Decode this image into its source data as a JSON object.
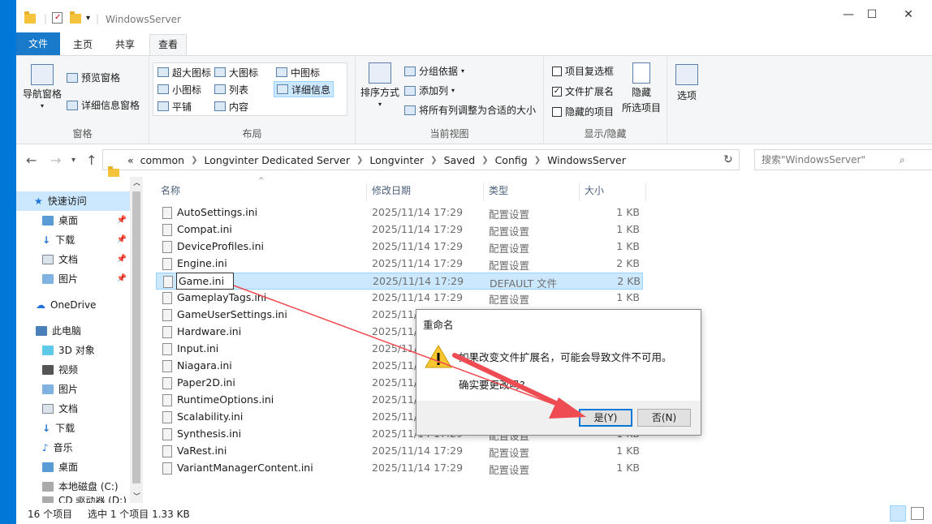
{
  "window": {
    "title": "WindowsServer",
    "minimize": "—",
    "maximize": "☐",
    "close": "✕"
  },
  "ribbon": {
    "tabs": [
      "文件",
      "主页",
      "共享",
      "查看"
    ],
    "panes": {
      "nav_pane": "导航窗格",
      "preview": "预览窗格",
      "details": "详细信息窗格",
      "label": "窗格"
    },
    "layout": {
      "items": [
        "超大图标",
        "大图标",
        "中图标",
        "小图标",
        "列表",
        "详细信息",
        "平铺",
        "内容"
      ],
      "label": "布局"
    },
    "current_view": {
      "sort": "排序方式",
      "group": "分组依据",
      "add_col": "添加列",
      "fit": "将所有列调整为合适的大小",
      "label": "当前视图"
    },
    "show_hide": {
      "checkbox": "项目复选框",
      "ext": "文件扩展名",
      "hidden": "隐藏的项目",
      "hide_sel_1": "隐藏",
      "hide_sel_2": "所选项目",
      "label": "显示/隐藏"
    },
    "options": "选项"
  },
  "address": {
    "overflow": "«",
    "segments": [
      "common",
      "Longvinter Dedicated Server",
      "Longvinter",
      "Saved",
      "Config",
      "WindowsServer"
    ],
    "refresh": "↻",
    "search_placeholder": "搜索\"WindowsServer\""
  },
  "nav": {
    "items": [
      {
        "label": "快速访问"
      },
      {
        "label": "桌面",
        "pin": "📌"
      },
      {
        "label": "下载",
        "pin": "📌"
      },
      {
        "label": "文档",
        "pin": "📌"
      },
      {
        "label": "图片",
        "pin": "📌"
      },
      {
        "label": "OneDrive"
      },
      {
        "label": "此电脑"
      },
      {
        "label": "3D 对象"
      },
      {
        "label": "视频"
      },
      {
        "label": "图片"
      },
      {
        "label": "文档"
      },
      {
        "label": "下载"
      },
      {
        "label": "音乐"
      },
      {
        "label": "桌面"
      },
      {
        "label": "本地磁盘 (C:)"
      },
      {
        "label": "CD 驱动器 (D:)"
      }
    ]
  },
  "columns": {
    "name": "名称",
    "date": "修改日期",
    "type": "类型",
    "size": "大小"
  },
  "files": [
    {
      "name": "AutoSettings.ini",
      "date": "2025/11/14 17:29",
      "type": "配置设置",
      "size": "1 KB"
    },
    {
      "name": "Compat.ini",
      "date": "2025/11/14 17:29",
      "type": "配置设置",
      "size": "1 KB"
    },
    {
      "name": "DeviceProfiles.ini",
      "date": "2025/11/14 17:29",
      "type": "配置设置",
      "size": "1 KB"
    },
    {
      "name": "Engine.ini",
      "date": "2025/11/14 17:29",
      "type": "配置设置",
      "size": "2 KB"
    },
    {
      "name": "Game.ini",
      "date": "2025/11/14 17:29",
      "type": "DEFAULT 文件",
      "size": "2 KB"
    },
    {
      "name": "GameplayTags.ini",
      "date": "2025/11/14 17:29",
      "type": "配置设置",
      "size": "1 KB"
    },
    {
      "name": "GameUserSettings.ini",
      "date": "2025/11/1",
      "type": "",
      "size": ""
    },
    {
      "name": "Hardware.ini",
      "date": "2025/11/1",
      "type": "",
      "size": ""
    },
    {
      "name": "Input.ini",
      "date": "2025/11/1",
      "type": "",
      "size": ""
    },
    {
      "name": "Niagara.ini",
      "date": "2025/11/1",
      "type": "",
      "size": ""
    },
    {
      "name": "Paper2D.ini",
      "date": "2025/11/1",
      "type": "",
      "size": ""
    },
    {
      "name": "RuntimeOptions.ini",
      "date": "2025/11/1",
      "type": "",
      "size": ""
    },
    {
      "name": "Scalability.ini",
      "date": "2025/11/1",
      "type": "",
      "size": ""
    },
    {
      "name": "Synthesis.ini",
      "date": "2025/11/14 17:29",
      "type": "配置设置",
      "size": "1 KB"
    },
    {
      "name": "VaRest.ini",
      "date": "2025/11/14 17:29",
      "type": "配置设置",
      "size": "1 KB"
    },
    {
      "name": "VariantManagerContent.ini",
      "date": "2025/11/14 17:29",
      "type": "配置设置",
      "size": "1 KB"
    }
  ],
  "rename_value": "Game.ini",
  "status": {
    "count": "16 个项目",
    "selected": "选中 1 个项目  1.33 KB"
  },
  "dialog": {
    "title": "重命名",
    "message": "如果改变文件扩展名，可能会导致文件不可用。",
    "question": "确实要更改吗?",
    "yes": "是(Y)",
    "no": "否(N)"
  }
}
